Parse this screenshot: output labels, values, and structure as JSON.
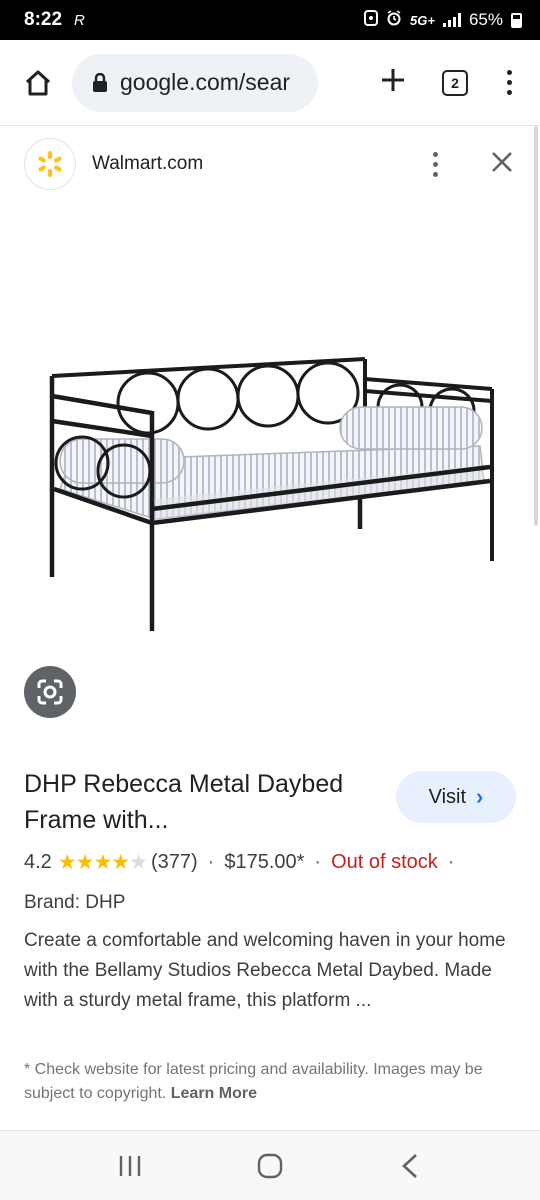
{
  "status_bar": {
    "time": "8:22",
    "r_glyph": "R",
    "network": "5G+",
    "battery": "65%"
  },
  "browser": {
    "url": "google.com/sear",
    "tab_count": "2"
  },
  "panel": {
    "source_name": "Walmart.com",
    "title": "DHP Rebecca Metal Daybed Frame with...",
    "visit_label": "Visit",
    "rating": "4.2",
    "rating_stars": 4.2,
    "review_count": "(377)",
    "price": "$175.00*",
    "stock_status": "Out of stock",
    "brand": "Brand: DHP",
    "description": "Create a comfortable and welcoming haven in your home with the Bellamy Studios Rebecca Metal Daybed. Made with a sturdy metal frame, this platform ...",
    "footnote": "* Check website for latest pricing and availability. Images may be subject to copyright.",
    "learn_more": "Learn More"
  },
  "colors": {
    "accent": "#1a73e8",
    "star": "#fbbc04",
    "out_of_stock": "#c5221f",
    "walmart_yellow": "#ffc220"
  },
  "icons": {
    "home": "home-icon",
    "lock": "lock-icon",
    "new_tab": "plus-icon",
    "menu": "more-vert-icon",
    "close": "close-icon",
    "lens": "google-lens-icon",
    "walmart": "walmart-spark-icon"
  }
}
